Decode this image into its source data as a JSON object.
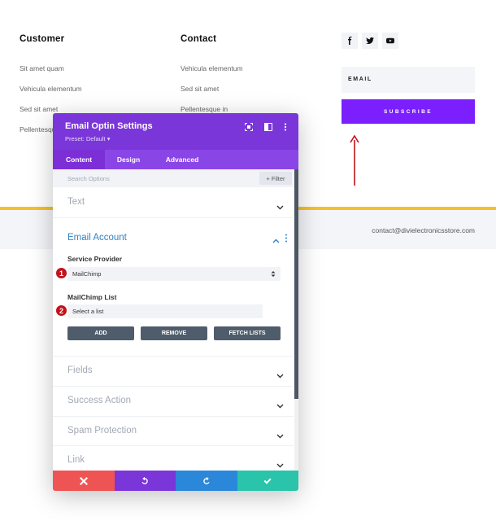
{
  "footer": {
    "customer": {
      "title": "Customer",
      "links": [
        "Sit amet quam",
        "Vehicula elementum",
        "Sed sit amet",
        "Pellentesque in"
      ]
    },
    "contact": {
      "title": "Contact",
      "links": [
        "Vehicula elementum",
        "Sed sit amet",
        "Pellentesque in"
      ]
    },
    "social": [
      "facebook-icon",
      "twitter-icon",
      "youtube-icon"
    ],
    "email_label": "EMAIL",
    "subscribe_label": "SUBSCRIBE",
    "contact_email": "contact@divielectronicsstore.com",
    "colors": {
      "accent": "#7b1fff",
      "divider": "#f7c02a",
      "arrow": "#c2121b"
    }
  },
  "modal": {
    "title": "Email Optin Settings",
    "preset": "Preset: Default ▾",
    "tabs": [
      {
        "label": "Content",
        "active": true
      },
      {
        "label": "Design",
        "active": false
      },
      {
        "label": "Advanced",
        "active": false
      }
    ],
    "search_placeholder": "Search Options",
    "filter_label": "+ Filter",
    "sections": {
      "text": "Text",
      "email_account": "Email Account",
      "fields": "Fields",
      "success_action": "Success Action",
      "spam_protection": "Spam Protection",
      "link": "Link"
    },
    "service_provider": {
      "label": "Service Provider",
      "value": "MailChimp"
    },
    "mailchimp_list": {
      "label": "MailChimp List",
      "value": "Select a list"
    },
    "buttons": {
      "add": "ADD",
      "remove": "REMOVE",
      "fetch": "FETCH LISTS"
    },
    "badges": [
      "1",
      "2"
    ],
    "colors": {
      "header": "#7b36d9",
      "tabs": "#8a45e6",
      "cancel": "#ef5454",
      "undo": "#7b36d9",
      "redo": "#2b87da",
      "save": "#29c4a9"
    }
  }
}
